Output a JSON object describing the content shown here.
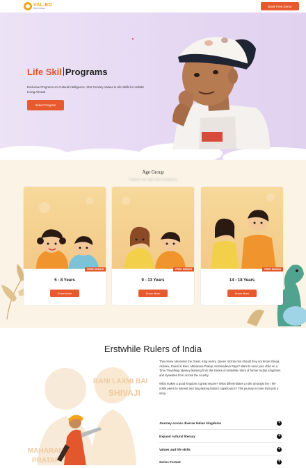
{
  "header": {
    "logo_name": "VAL-ED",
    "logo_sub": "INITIATIVES",
    "demo_label": "Book Free Demo"
  },
  "hero": {
    "title_accent": "Life Skil",
    "title_rest": "Programs",
    "description": "Exclusive Programs on Cultural Intelligence, 21st Century Values & Life Skills for Holistic Living Abroad",
    "button_label": "Select Program"
  },
  "age_group": {
    "title": "Age Group",
    "subtitle": "Explore our age-wise programs",
    "cards": [
      {
        "badge": "FREE DEMOS",
        "years": "5 - 8 Years",
        "button": "Know More"
      },
      {
        "badge": "FREE DEMOS",
        "years": "9 - 13 Years",
        "button": "Know More"
      },
      {
        "badge": "FREE DEMOS",
        "years": "14 - 18 Years",
        "button": "Know More"
      }
    ]
  },
  "rulers": {
    "title": "Erstwhile Rulers of India",
    "paragraph1": "They know Alexander the Great, King Henry, Queen Victoria but should they not know Shivaji, Ashoka, Jhansi ki Rani, Maharana Pratap, Krishnadeva Raya? Want to send your child on a Time Travelling odyssey learning from the stories of erstwhile rulers of former Indian kingdoms and dynasties from across the country.",
    "paragraph2": "What makes a good kingdom a great empire? What differentiates a ruler amongst her / her noble peers to interest and long-lasting historic significance? This journey is more than just a story.",
    "art_text1": "RANI LAXMI BAI",
    "art_text2": "SHIVAJI",
    "art_text3": "MAHARANA",
    "art_text4": "PRATAP",
    "accordion": [
      {
        "label": "Journey across diverse Indian kingdoms",
        "icon": "+"
      },
      {
        "label": "Expand cultural literacy",
        "icon": "+"
      },
      {
        "label": "Values and life skills",
        "icon": "+"
      },
      {
        "label": "Series Format",
        "icon": "+"
      }
    ]
  },
  "colors": {
    "accent": "#e75a2e",
    "logo": "#f3a21b",
    "hero_bg": "#e6d8f3",
    "age_bg": "#fbf3e6"
  }
}
